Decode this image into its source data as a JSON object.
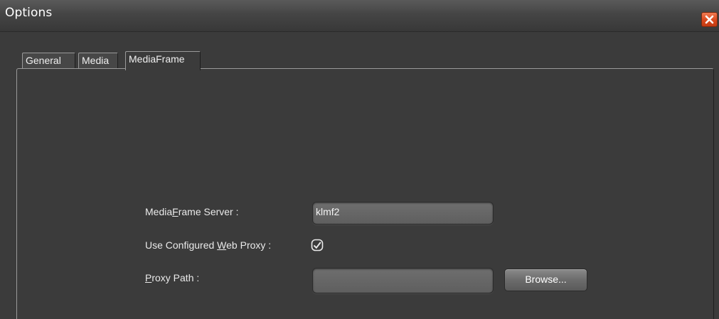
{
  "window": {
    "title": "Options"
  },
  "tabs": [
    {
      "label": "General",
      "active": false
    },
    {
      "label": "Media",
      "active": false
    },
    {
      "label": "MediaFrame",
      "active": true
    }
  ],
  "form": {
    "server_label_pre": "Media",
    "server_label_mnemonic": "F",
    "server_label_post": "rame Server :",
    "server_value": "klmf2",
    "proxy_label_pre": "Use Configured ",
    "proxy_label_mnemonic": "W",
    "proxy_label_post": "eb Proxy :",
    "proxy_checked": true,
    "path_label_mnemonic": "P",
    "path_label_post": "roxy Path :",
    "path_value": "",
    "browse_label": "Browse..."
  },
  "colors": {
    "background": "#3b3b3b",
    "close_button": "#d9481c",
    "field": "#666666",
    "text": "#eaeaea"
  },
  "icons": {
    "close": "close-x-icon",
    "check": "checkmark-icon"
  }
}
